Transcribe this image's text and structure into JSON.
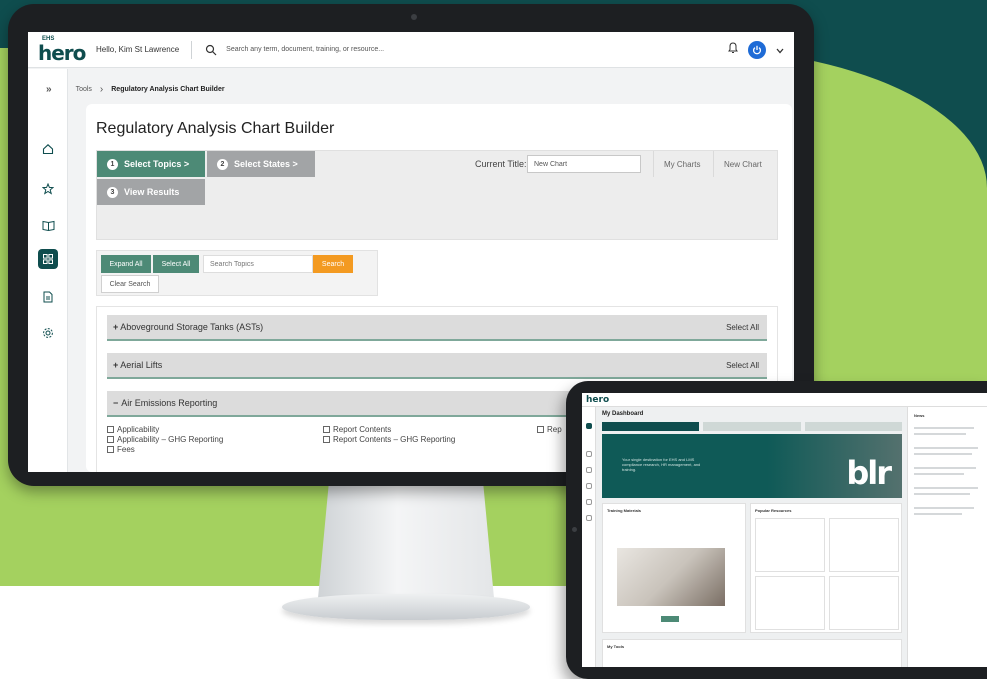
{
  "app": {
    "logo_top": "EHS",
    "logo_main": "hero",
    "greeting": "Hello, Kim St Lawrence",
    "search_placeholder": "Search any term, document, training, or resource..."
  },
  "breadcrumb": {
    "toggle": "»",
    "root": "Tools",
    "separator": "›",
    "current": "Regulatory Analysis Chart Builder"
  },
  "page": {
    "title": "Regulatory Analysis Chart Builder"
  },
  "wizard": {
    "steps": [
      {
        "num": "1",
        "label": "Select Topics >"
      },
      {
        "num": "2",
        "label": "Select States >"
      },
      {
        "num": "3",
        "label": "View Results"
      }
    ],
    "current_title_label": "Current Title:",
    "current_title_value": "New Chart",
    "my_charts": "My Charts",
    "new_chart": "New Chart"
  },
  "filter": {
    "expand_all": "Expand All",
    "select_all": "Select All",
    "search_placeholder": "Search Topics",
    "search_button": "Search",
    "clear_search": "Clear Search"
  },
  "topics": [
    {
      "label": "Aboveground Storage Tanks (ASTs)",
      "expanded": false,
      "select_all": "Select All"
    },
    {
      "label": "Aerial Lifts",
      "expanded": false,
      "select_all": "Select All"
    },
    {
      "label": "Air Emissions Reporting",
      "expanded": true,
      "select_all": ""
    }
  ],
  "subtopics": {
    "col1": [
      "Applicability",
      "Applicability – GHG Reporting",
      "Fees"
    ],
    "col2": [
      "Report Contents",
      "Report Contents – GHG Reporting"
    ],
    "col3": [
      "Rep"
    ]
  },
  "tablet": {
    "logo": "hero",
    "title": "My Dashboard",
    "banner_text": "Your single destination for EHS and LMS compliance research, HR management, and training.",
    "brand": "blr",
    "training_label": "Training Materials",
    "popular_label": "Popular Resources",
    "news_label": "News",
    "tools_label": "My Tools"
  }
}
